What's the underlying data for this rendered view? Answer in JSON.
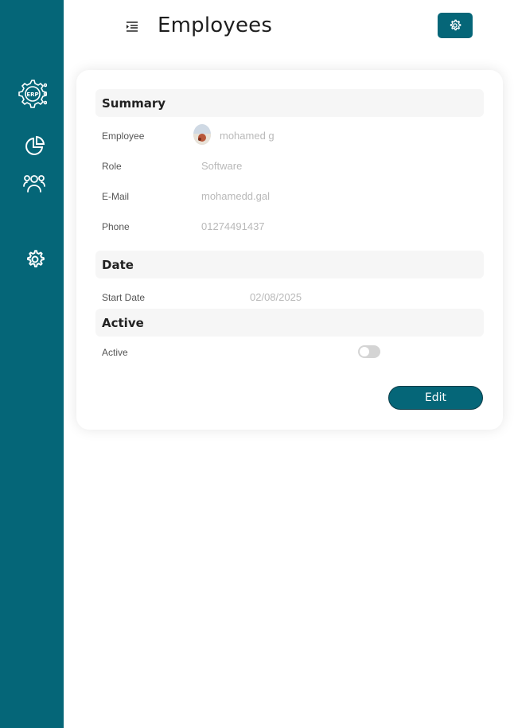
{
  "sidebar": {
    "logo_text": "ERP",
    "items": [
      {
        "name": "dashboard",
        "icon": "pie-chart-icon"
      },
      {
        "name": "employees",
        "icon": "users-icon"
      },
      {
        "name": "settings",
        "icon": "gear-icon"
      }
    ]
  },
  "header": {
    "title": "Employees",
    "menu_icon": "indent-menu-icon",
    "settings_icon": "gear-icon"
  },
  "summary": {
    "heading": "Summary",
    "employee_label": "Employee",
    "employee_value": "mohamed g",
    "role_label": "Role",
    "role_value": "Software",
    "email_label": "E-Mail",
    "email_value": "mohamedd.gal",
    "phone_label": "Phone",
    "phone_value": "01274491437"
  },
  "date": {
    "heading": "Date",
    "start_label": "Start Date",
    "start_value": "02/08/2025"
  },
  "active": {
    "heading": "Active",
    "label": "Active",
    "value": false
  },
  "actions": {
    "edit_label": "Edit"
  },
  "colors": {
    "brand": "#056678",
    "section_bg": "#f6f6f6",
    "muted_text": "#b9b9b9"
  }
}
